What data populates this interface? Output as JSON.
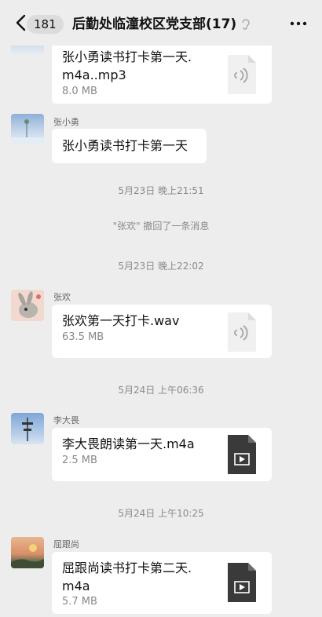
{
  "header": {
    "unread_count": "181",
    "title": "后勤处临潼校区党支部(17)"
  },
  "messages": [
    {
      "file_name_lines": [
        "张小勇读书打卡第一天.",
        "m4a..mp3"
      ],
      "file_size": "8.0 MB",
      "icon": "audio-file-icon"
    },
    {
      "sender": "张小勇",
      "text": "张小勇读书打卡第一天"
    },
    {
      "timestamp": "5月23日 晚上21:51"
    },
    {
      "system_text": "\"张欢\" 撤回了一条消息"
    },
    {
      "timestamp": "5月23日 晚上22:02"
    },
    {
      "sender": "张欢",
      "file_name_lines": [
        "张欢第一天打卡.wav"
      ],
      "file_size": "63.5 MB",
      "icon": "audio-file-icon"
    },
    {
      "timestamp": "5月24日 上午06:36"
    },
    {
      "sender": "李大畏",
      "file_name_lines": [
        "李大畏朗读第一天.m4a"
      ],
      "file_size": "2.5 MB",
      "icon": "video-file-icon"
    },
    {
      "timestamp": "5月24日 上午10:25"
    },
    {
      "sender": "屈跟尚",
      "file_name_lines": [
        "屈跟尚读书打卡第二天.",
        "m4a"
      ],
      "file_size": "5.7 MB",
      "icon": "video-file-icon"
    }
  ],
  "colors": {
    "background": "#ededed",
    "bubble": "#ffffff",
    "meta_text": "#8a8a8a"
  }
}
